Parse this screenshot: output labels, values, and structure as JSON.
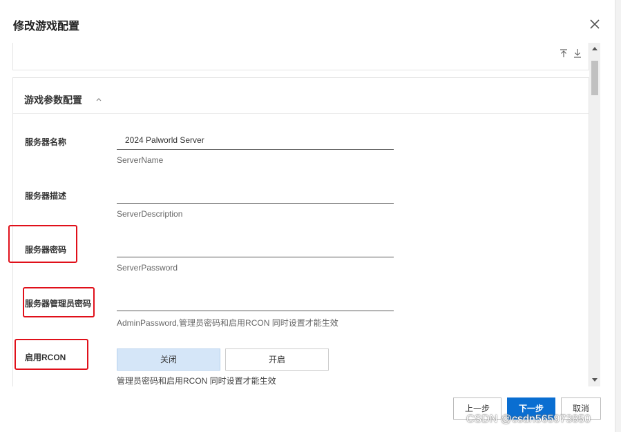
{
  "dialog": {
    "title": "修改游戏配置"
  },
  "section": {
    "title": "游戏参数配置"
  },
  "fields": [
    {
      "label": "服务器名称",
      "value": "2024 Palworld Server",
      "hint": "ServerName"
    },
    {
      "label": "服务器描述",
      "value": "",
      "hint": "ServerDescription"
    },
    {
      "label": "服务器密码",
      "value": "",
      "hint": "ServerPassword"
    },
    {
      "label": "服务器管理员密码",
      "value": "",
      "hint": "AdminPassword,管理员密码和启用RCON 同时设置才能生效"
    }
  ],
  "rcon": {
    "label": "启用RCON",
    "options": [
      "关闭",
      "开启"
    ],
    "selected": "关闭",
    "hint": "管理员密码和启用RCON 同时设置才能生效"
  },
  "footer": {
    "prev": "上一步",
    "next": "下一步",
    "cancel": "取消"
  },
  "watermark": "CSDN @csdn565973850",
  "colors": {
    "primary": "#0a6ed1",
    "highlight": "#e0101a",
    "selected": "#d5e6f8"
  }
}
